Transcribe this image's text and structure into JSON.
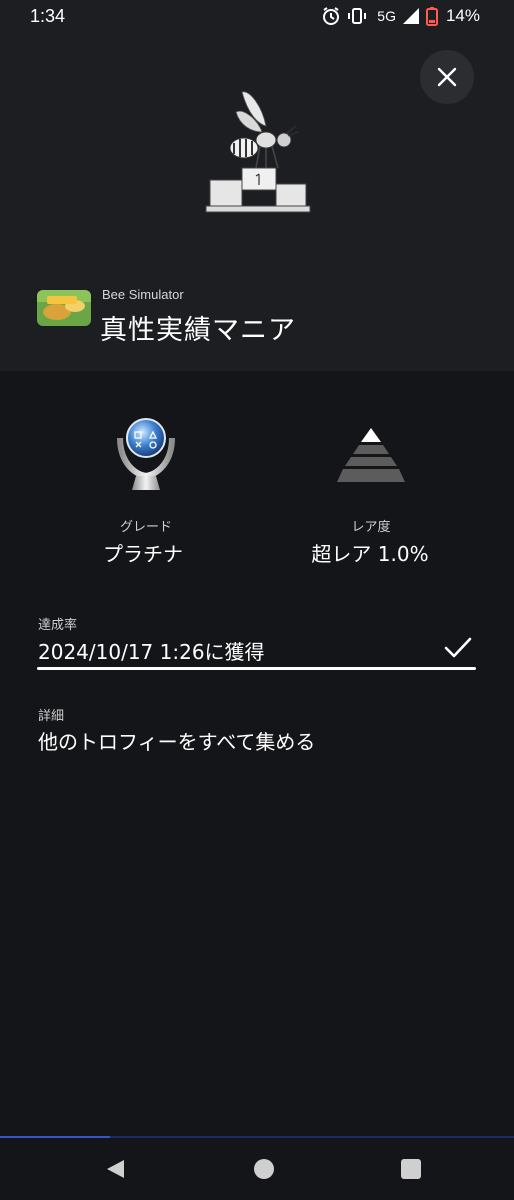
{
  "status_bar": {
    "time": "1:34",
    "network": "5G",
    "battery": "14%",
    "icons": [
      "alarm-icon",
      "vibrate-icon",
      "signal-icon",
      "battery-icon"
    ]
  },
  "trophy": {
    "game_name": "Bee Simulator",
    "title": "真性実績マニア",
    "grade_label": "グレード",
    "grade_value": "プラチナ",
    "rarity_label": "レア度",
    "rarity_value": "超レア 1.0%",
    "earned_label": "達成率",
    "earned_value": "2024/10/17  1:26に獲得",
    "detail_label": "詳細",
    "detail_value": "他のトロフィーをすべて集める",
    "icons": [
      "platinum-trophy-icon",
      "rarity-pyramid-icon",
      "checkmark-icon",
      "bee-podium-art"
    ]
  },
  "colors": {
    "background": "#141518",
    "panel": "#1d1e21",
    "accent_blue": "#3456c8"
  },
  "nav": [
    "back-icon",
    "home-icon",
    "recents-icon"
  ]
}
